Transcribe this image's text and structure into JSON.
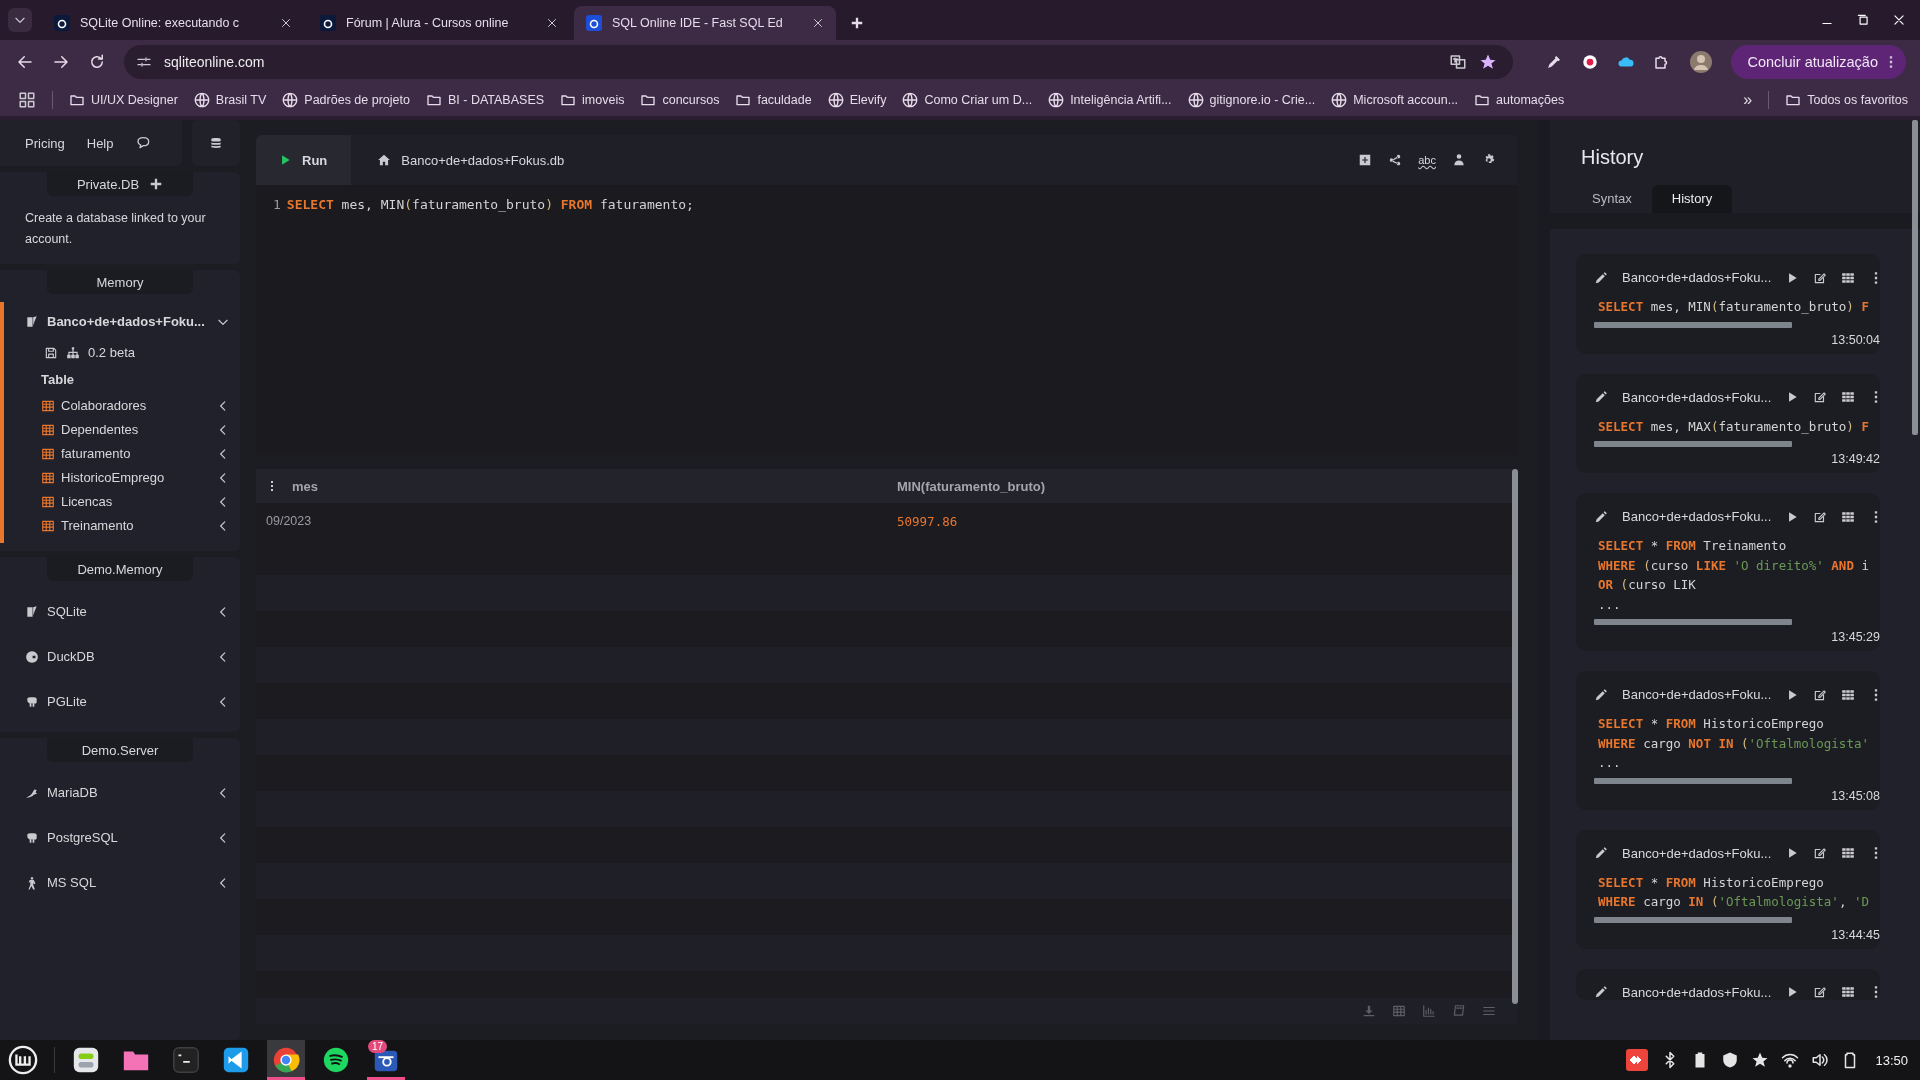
{
  "browser": {
    "tabs": [
      {
        "title": "SQLite Online: executando c",
        "selected": false
      },
      {
        "title": "Fórum | Alura - Cursos online",
        "selected": false
      },
      {
        "title": "SQL Online IDE - Fast SQL Ed",
        "selected": true
      }
    ],
    "address": "sqliteonline.com",
    "update_button": "Concluir atualização",
    "bookmarks": [
      {
        "label": "UI/UX Designer",
        "kind": "folder"
      },
      {
        "label": "Brasil TV",
        "kind": "site"
      },
      {
        "label": "Padrões de projeto",
        "kind": "site"
      },
      {
        "label": "BI - DATABASES",
        "kind": "folder"
      },
      {
        "label": "imoveis",
        "kind": "folder"
      },
      {
        "label": "concursos",
        "kind": "folder"
      },
      {
        "label": "faculdade",
        "kind": "folder"
      },
      {
        "label": "Elevify",
        "kind": "site"
      },
      {
        "label": "Como Criar um D...",
        "kind": "site"
      },
      {
        "label": "Inteligência Artifi...",
        "kind": "site"
      },
      {
        "label": "gitignore.io - Crie...",
        "kind": "site"
      },
      {
        "label": "Microsoft accoun...",
        "kind": "site"
      },
      {
        "label": "automações",
        "kind": "folder"
      }
    ],
    "bookmarks_overflow": "»",
    "all_bookmarks": "Todos os favoritos"
  },
  "sidebar": {
    "links": [
      "Pricing",
      "Help"
    ],
    "private": {
      "title": "Private.DB",
      "description": "Create a database linked to your account."
    },
    "memory": {
      "title": "Memory",
      "database": {
        "name": "Banco+de+dados+Foku...",
        "selected": true,
        "expanded": true,
        "version": "0.2 beta",
        "group": "Table",
        "tables": [
          "Colaboradores",
          "Dependentes",
          "faturamento",
          "HistoricoEmprego",
          "Licencas",
          "Treinamento"
        ]
      }
    },
    "demo_memory": {
      "title": "Demo.Memory",
      "items": [
        "SQLite",
        "DuckDB",
        "PGLite"
      ]
    },
    "demo_server": {
      "title": "Demo.Server",
      "items": [
        "MariaDB",
        "PostgreSQL",
        "MS SQL"
      ]
    }
  },
  "editor": {
    "run": "Run",
    "file_tab": "Banco+de+dados+Fokus.db",
    "spell_label": "abc",
    "lines": [
      {
        "number": "1",
        "tokens": [
          {
            "kind": "kw",
            "text": "SELECT"
          },
          {
            "kind": "plain",
            "text": " mes, MIN"
          },
          {
            "kind": "punct",
            "text": "("
          },
          {
            "kind": "plain",
            "text": "faturamento_bruto"
          },
          {
            "kind": "punct",
            "text": ") "
          },
          {
            "kind": "kw",
            "text": "FROM"
          },
          {
            "kind": "plain",
            "text": " faturamento;"
          }
        ]
      }
    ]
  },
  "results": {
    "columns": [
      "mes",
      "MIN(faturamento_bruto)"
    ],
    "rows": [
      [
        "09/2023",
        "50997.86"
      ]
    ]
  },
  "history": {
    "title": "History",
    "tabs": [
      {
        "label": "Syntax",
        "selected": false
      },
      {
        "label": "History",
        "selected": true
      }
    ],
    "entries": [
      {
        "db": "Banco+de+dados+Foku...",
        "time": "13:50:04",
        "lines": [
          [
            {
              "kind": "kw",
              "text": "SELECT"
            },
            {
              "kind": "plain",
              "text": " mes, MIN"
            },
            {
              "kind": "punct",
              "text": "("
            },
            {
              "kind": "plain",
              "text": "faturamento_bruto"
            },
            {
              "kind": "punct",
              "text": ") "
            },
            {
              "kind": "kw",
              "text": "F"
            }
          ]
        ]
      },
      {
        "db": "Banco+de+dados+Foku...",
        "time": "13:49:42",
        "lines": [
          [
            {
              "kind": "kw",
              "text": "SELECT"
            },
            {
              "kind": "plain",
              "text": " mes, MAX"
            },
            {
              "kind": "punct",
              "text": "("
            },
            {
              "kind": "plain",
              "text": "faturamento_bruto"
            },
            {
              "kind": "punct",
              "text": ") "
            },
            {
              "kind": "kw",
              "text": "F"
            }
          ]
        ]
      },
      {
        "db": "Banco+de+dados+Foku...",
        "time": "13:45:29",
        "lines": [
          [
            {
              "kind": "kw",
              "text": "SELECT"
            },
            {
              "kind": "plain",
              "text": " * "
            },
            {
              "kind": "kw",
              "text": "FROM"
            },
            {
              "kind": "plain",
              "text": " Treinamento"
            }
          ],
          [
            {
              "kind": "kw",
              "text": "WHERE"
            },
            {
              "kind": "punct",
              "text": " ("
            },
            {
              "kind": "plain",
              "text": "curso "
            },
            {
              "kind": "kw",
              "text": "LIKE"
            },
            {
              "kind": "str",
              "text": " 'O direito%' "
            },
            {
              "kind": "kw",
              "text": "AND"
            },
            {
              "kind": "plain",
              "text": " i"
            }
          ],
          [
            {
              "kind": "kw",
              "text": "OR"
            },
            {
              "kind": "punct",
              "text": " ("
            },
            {
              "kind": "plain",
              "text": "curso LIK"
            }
          ],
          [
            {
              "kind": "plain",
              "text": "..."
            }
          ]
        ]
      },
      {
        "db": "Banco+de+dados+Foku...",
        "time": "13:45:08",
        "lines": [
          [
            {
              "kind": "kw",
              "text": "SELECT"
            },
            {
              "kind": "plain",
              "text": " * "
            },
            {
              "kind": "kw",
              "text": "FROM"
            },
            {
              "kind": "plain",
              "text": " HistoricoEmprego"
            }
          ],
          [
            {
              "kind": "kw",
              "text": "WHERE"
            },
            {
              "kind": "plain",
              "text": " cargo "
            },
            {
              "kind": "kw",
              "text": "NOT IN"
            },
            {
              "kind": "punct",
              "text": " ("
            },
            {
              "kind": "str",
              "text": "'Oftalmologista'"
            }
          ],
          [
            {
              "kind": "plain",
              "text": "..."
            }
          ]
        ]
      },
      {
        "db": "Banco+de+dados+Foku...",
        "time": "13:44:45",
        "lines": [
          [
            {
              "kind": "kw",
              "text": "SELECT"
            },
            {
              "kind": "plain",
              "text": " * "
            },
            {
              "kind": "kw",
              "text": "FROM"
            },
            {
              "kind": "plain",
              "text": " HistoricoEmprego"
            }
          ],
          [
            {
              "kind": "kw",
              "text": "WHERE"
            },
            {
              "kind": "plain",
              "text": " cargo "
            },
            {
              "kind": "kw",
              "text": "IN"
            },
            {
              "kind": "punct",
              "text": " ("
            },
            {
              "kind": "str",
              "text": "'Oftalmologista'"
            },
            {
              "kind": "plain",
              "text": ", "
            },
            {
              "kind": "str",
              "text": "'D"
            }
          ]
        ]
      },
      {
        "db": "Banco+de+dados+Foku..."
      }
    ]
  },
  "taskbar": {
    "apps": [
      {
        "selected": false,
        "running": false
      },
      {
        "selected": false,
        "running": false
      },
      {
        "selected": false,
        "running": false
      },
      {
        "selected": false,
        "running": false
      },
      {
        "selected": false,
        "running": false
      },
      {
        "selected": true,
        "running": true
      },
      {
        "selected": false,
        "running": false
      },
      {
        "selected": false,
        "running": true,
        "badge": "17"
      }
    ],
    "time": "13:50"
  }
}
